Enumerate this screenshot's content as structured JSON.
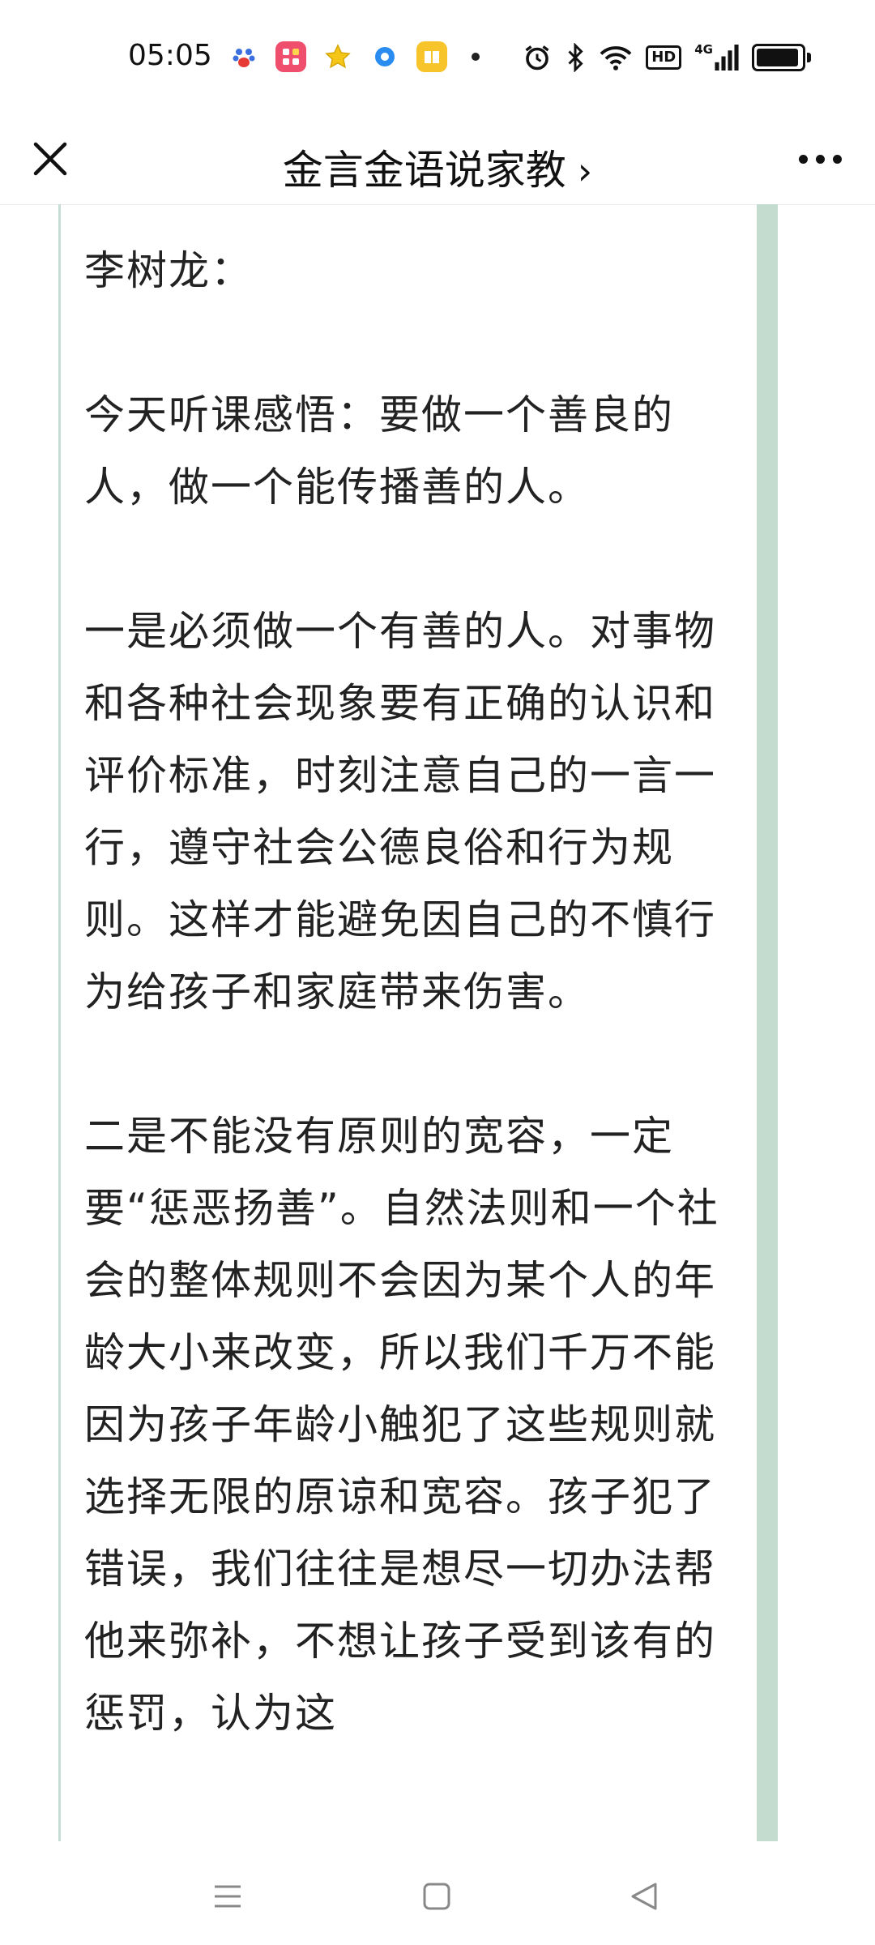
{
  "status_bar": {
    "time": "05:05",
    "app_icons": [
      "baidu-icon",
      "app-grid-icon",
      "star-icon",
      "browser-icon",
      "book-icon"
    ],
    "network": "4G",
    "hd_label": "HD",
    "battery_level": 0.95
  },
  "header": {
    "title": "金言金语说家教",
    "chevron": "›"
  },
  "article": {
    "author_line": "李树龙：",
    "paragraphs": [
      "今天听课感悟：要做一个善良的人，做一个能传播善的人。",
      "一是必须做一个有善的人。对事物和各种社会现象要有正确的认识和评价标准，时刻注意自己的一言一行，遵守社会公德良俗和行为规则。这样才能避免因自己的不慎行为给孩子和家庭带来伤害。",
      "二是不能没有原则的宽容，一定要“惩恶扬善”。自然法则和一个社会的整体规则不会因为某个人的年龄大小来改变，所以我们千万不能因为孩子年龄小触犯了这些规则就选择无限的原谅和宽容。孩子犯了错误，我们往往是想尽一切办法帮他来弥补，不想让孩子受到该有的惩罚，认为这"
    ]
  },
  "colors": {
    "accent_bar": "#c4dccf",
    "text": "#222222"
  }
}
